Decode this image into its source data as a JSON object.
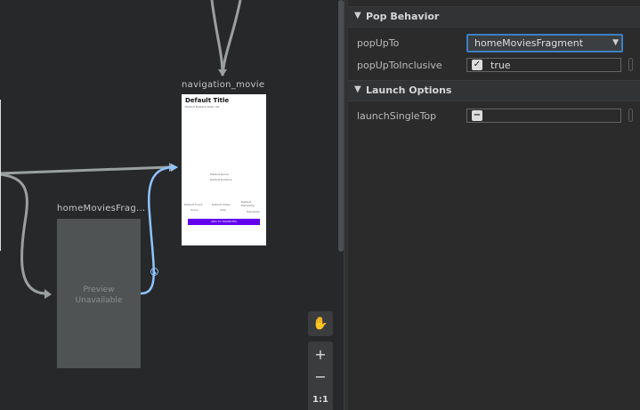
{
  "canvas": {
    "dest_nav_label": "navigation_movie",
    "dest_home_label": "homeMoviesFrag...",
    "nav_preview": {
      "title": "Default Title",
      "subtitle": "Default Release Date: Yet",
      "genre": "Default Genre",
      "runtime": "Default Runtime",
      "score_label": "Default Score",
      "score_sub": "Score",
      "votes_label": "Default Votes",
      "votes_sub": "Vote",
      "popularity_label": "Default Popularity",
      "popularity_sub": "Popularity",
      "button": "ADD TO FAVORITES"
    },
    "home_preview_line1": "Preview",
    "home_preview_line2": "Unavailable"
  },
  "toolbar": {
    "pan_icon": "hand-icon",
    "zoom_in": "+",
    "zoom_out": "−",
    "zoom_reset": "1:1"
  },
  "panel": {
    "pop_section": "Pop Behavior",
    "popupto_label": "popUpTo",
    "popupto_value": "homeMoviesFragment",
    "popuptoinclusive_label": "popUpToInclusive",
    "popuptoinclusive_value": "true",
    "launch_section": "Launch Options",
    "launchsingletop_label": "launchSingleTop"
  },
  "colors": {
    "accent": "#3e7fc4",
    "action_selected": "#8fc4ff",
    "action_default": "#9aa0a0",
    "button_purple": "#6200ee"
  }
}
